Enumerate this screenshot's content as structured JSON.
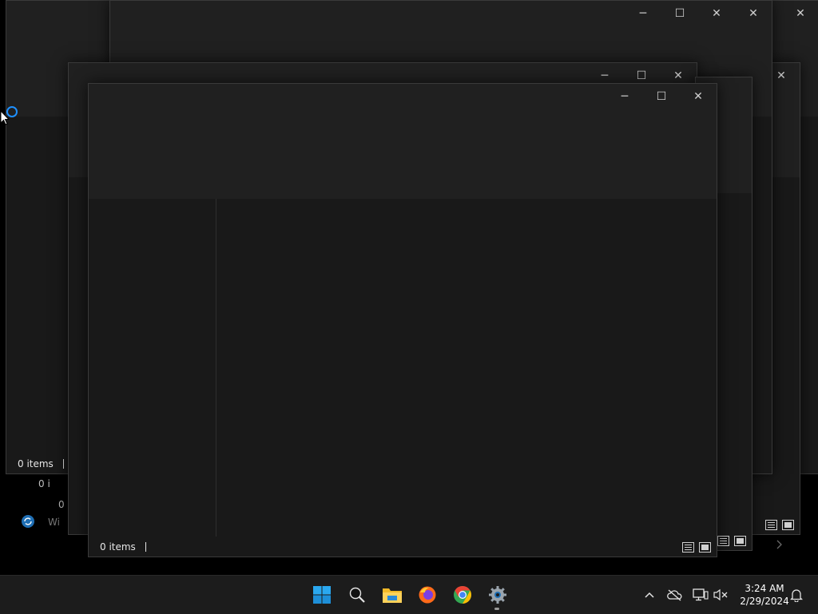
{
  "windows": {
    "count_label": "0 items",
    "caption": {
      "minimize": "─",
      "maximize": "☐",
      "close": "✕"
    }
  },
  "peek_texts": [
    "0 i",
    "0 i",
    "0 i",
    "Wi"
  ],
  "taskbar": {
    "apps": [
      {
        "name": "start-button",
        "icon": "windows-logo-icon"
      },
      {
        "name": "search-button",
        "icon": "search-icon"
      },
      {
        "name": "file-explorer",
        "icon": "folder-icon"
      },
      {
        "name": "firefox",
        "icon": "firefox-icon"
      },
      {
        "name": "chrome",
        "icon": "chrome-icon"
      },
      {
        "name": "settings",
        "icon": "gear-icon"
      }
    ],
    "time": "3:24 AM",
    "date": "2/29/2024"
  },
  "colors": {
    "accent": "#1e90ff",
    "window_bg": "#191919",
    "header_bg": "#202020",
    "taskbar_bg": "#1c1c1c"
  }
}
